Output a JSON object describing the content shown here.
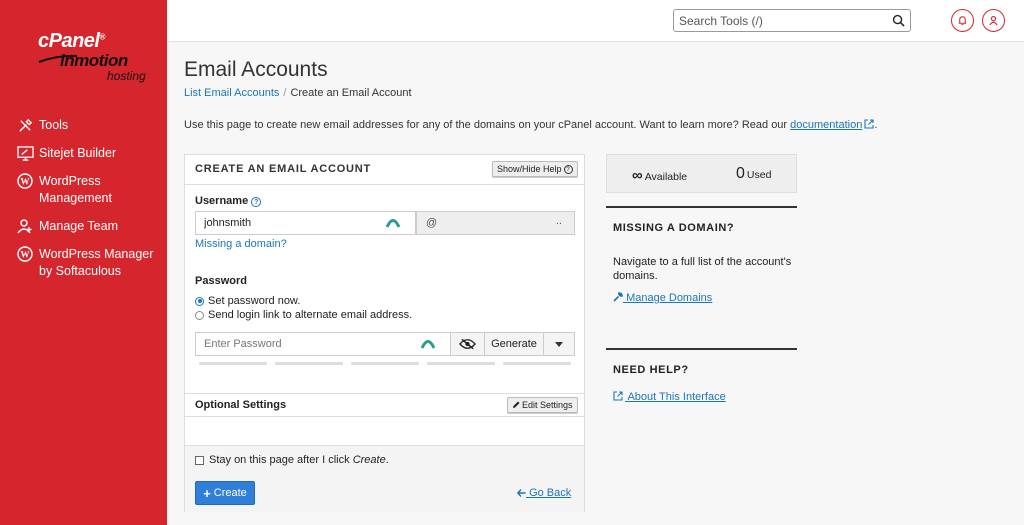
{
  "brand": {
    "cpanel": "cPanel",
    "cpanel_reg": "®",
    "inmotion": "inmotion",
    "hosting": "hosting",
    "color": "#d6262d"
  },
  "sidebar": {
    "items": [
      {
        "label": "Tools",
        "icon": "tools-icon"
      },
      {
        "label": "Sitejet Builder",
        "icon": "sitejet-icon"
      },
      {
        "label": "WordPress Management",
        "icon": "wordpress-icon"
      },
      {
        "label": "Manage Team",
        "icon": "manage-team-icon"
      },
      {
        "label": "WordPress Manager by Softaculous",
        "icon": "wordpress-icon"
      }
    ]
  },
  "header": {
    "search_placeholder": "Search Tools (/)"
  },
  "page": {
    "title": "Email Accounts",
    "breadcrumb": {
      "parent": "List Email Accounts",
      "separator": "/",
      "current": "Create an Email Account"
    },
    "intro_text": "Use this page to create new email addresses for any of the domains on your cPanel account. Want to learn more? Read our",
    "intro_link": "documentation",
    "intro_end": "."
  },
  "form": {
    "title": "CREATE AN EMAIL ACCOUNT",
    "show_hide_help": "Show/Hide Help",
    "username_label": "Username",
    "username_value": "johnsmith",
    "domain_at": "@",
    "domain_value": "..",
    "missing_domain": "Missing a domain?",
    "password_label": "Password",
    "radio_set": "Set password now.",
    "radio_send": "Send login link to alternate email address.",
    "password_placeholder": "Enter Password",
    "generate": "Generate",
    "optional_settings": "Optional Settings",
    "edit_settings": "Edit Settings",
    "stay_text": "Stay on this page after I click",
    "stay_em": "Create",
    "stay_end": ".",
    "create": "Create",
    "go_back": "Go Back"
  },
  "stats": {
    "available_symbol": "∞",
    "available_label": "Available",
    "used_value": "0",
    "used_label": "Used"
  },
  "missing_domain_section": {
    "title": "MISSING A DOMAIN?",
    "text": "Navigate to a full list of the account's domains.",
    "link": "Manage Domains"
  },
  "help_section": {
    "title": "NEED HELP?",
    "link": "About This Interface"
  }
}
